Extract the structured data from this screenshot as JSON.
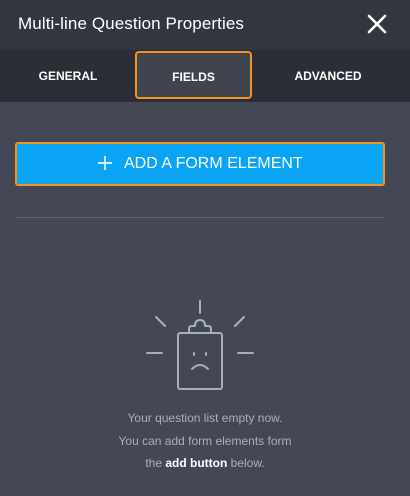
{
  "header": {
    "title": "Multi-line Question Properties",
    "close_icon": "close-icon"
  },
  "tabs": [
    {
      "label": "GENERAL",
      "active": false
    },
    {
      "label": "FIELDS",
      "active": true
    },
    {
      "label": "ADVANCED",
      "active": false
    }
  ],
  "add_button": {
    "icon": "plus-icon",
    "label": "ADD A FORM ELEMENT"
  },
  "empty_state": {
    "icon": "sad-clipboard-icon",
    "line1": "Your question list empty now.",
    "line2": "You can add form elements form",
    "line3_pre": "the ",
    "line3_strong": "add button",
    "line3_post": " below."
  },
  "colors": {
    "header_bg": "#32363f",
    "tabs_bg": "#2b2e36",
    "panel_bg": "#434854",
    "accent_orange": "#f5931d",
    "button_blue": "#09a4f6",
    "muted_text": "#a7afbd"
  }
}
